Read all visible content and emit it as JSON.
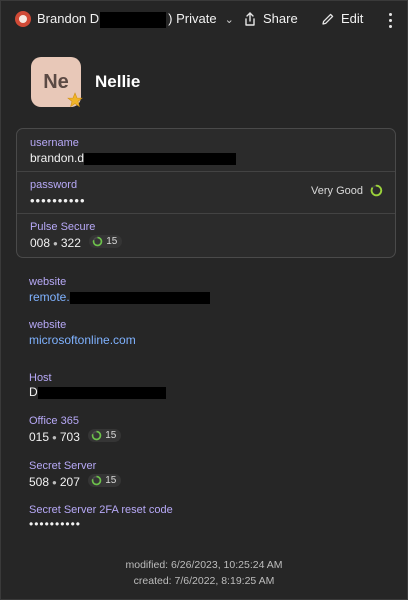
{
  "header": {
    "vault_prefix": "Brandon D",
    "vault_suffix": ")",
    "vault_label": "Private",
    "share_label": "Share",
    "edit_label": "Edit"
  },
  "item": {
    "avatar_initials": "Ne",
    "title": "Nellie"
  },
  "card": {
    "username_label": "username",
    "username_value": "brandon.d",
    "password_label": "password",
    "password_value": "••••••••••",
    "strength_label": "Very Good",
    "pulse_label": "Pulse Secure",
    "pulse_code_a": "008",
    "pulse_code_b": "322",
    "pulse_seconds": "15"
  },
  "fields": {
    "website1_label": "website",
    "website1_value": "remote.",
    "website2_label": "website",
    "website2_value": "microsoftonline.com",
    "host_label": "Host",
    "host_value": "D",
    "office_label": "Office 365",
    "office_code_a": "015",
    "office_code_b": "703",
    "office_seconds": "15",
    "secret_label": "Secret Server",
    "secret_code_a": "508",
    "secret_code_b": "207",
    "secret_seconds": "15",
    "reset_label": "Secret Server 2FA reset code",
    "reset_value": "••••••••••"
  },
  "footer": {
    "modified": "modified: 6/26/2023, 10:25:24 AM",
    "created": "created: 7/6/2022, 8:19:25 AM"
  },
  "colors": {
    "background": "#262626",
    "label_purple": "#b7a9f7",
    "link_blue": "#7fb2ff",
    "strength_green": "#9bd33a",
    "avatar_bg": "#e8c8b8",
    "star_gold": "#f0b429"
  },
  "icons": {
    "vault": "vault-icon",
    "share": "share-icon",
    "edit": "pencil-icon",
    "more": "more-vertical-icon",
    "favorite": "star-icon",
    "strength": "strength-ring-icon",
    "otp_timer": "otp-timer-icon"
  }
}
